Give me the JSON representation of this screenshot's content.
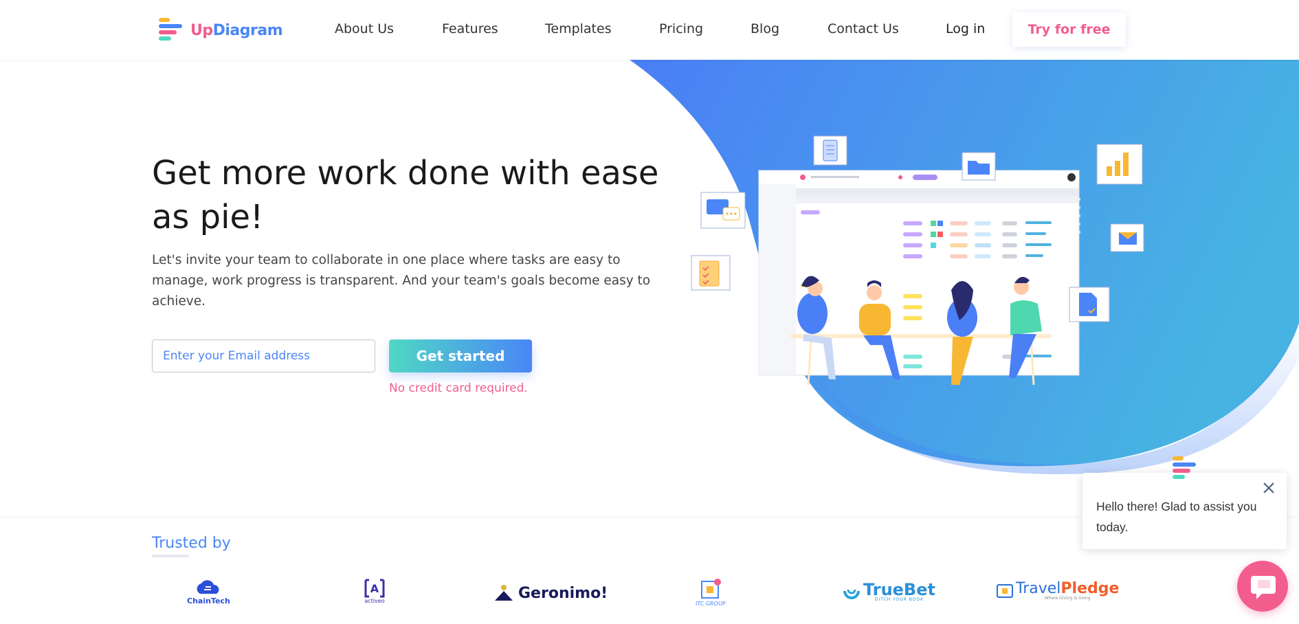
{
  "brand": {
    "name_part1": "Up",
    "name_part2": "Diagram"
  },
  "nav": {
    "items": [
      "About Us",
      "Features",
      "Templates",
      "Pricing",
      "Blog",
      "Contact Us"
    ],
    "login": "Log in",
    "cta": "Try for free"
  },
  "hero": {
    "title": "Get more work done with ease as pie!",
    "description": "Let's invite your team to collaborate in one place where tasks are easy to manage, work progress is transparent. And your team's goals become easy to achieve.",
    "email_placeholder": "Enter your Email address",
    "cta": "Get started",
    "note": "No credit card required."
  },
  "trusted": {
    "heading": "Trusted by",
    "logos": {
      "chaintech": "ChainTech",
      "activeo": "activeo",
      "geronimo": "Geronimo!",
      "itc": "ITC GROUP",
      "truebet": "TrueBet",
      "truebet_tagline": "DITCH YOUR BOOK",
      "travelpledge_a": "Travel",
      "travelpledge_b": "Pledge",
      "travelpledge_tagline": "Where Giving Is Going"
    }
  },
  "chat": {
    "message": "Hello there! Glad to assist you today."
  },
  "colors": {
    "accent_blue": "#4a86f7",
    "accent_pink": "#f25d8e",
    "accent_teal": "#4fd8c4",
    "accent_yellow": "#f7b733"
  }
}
